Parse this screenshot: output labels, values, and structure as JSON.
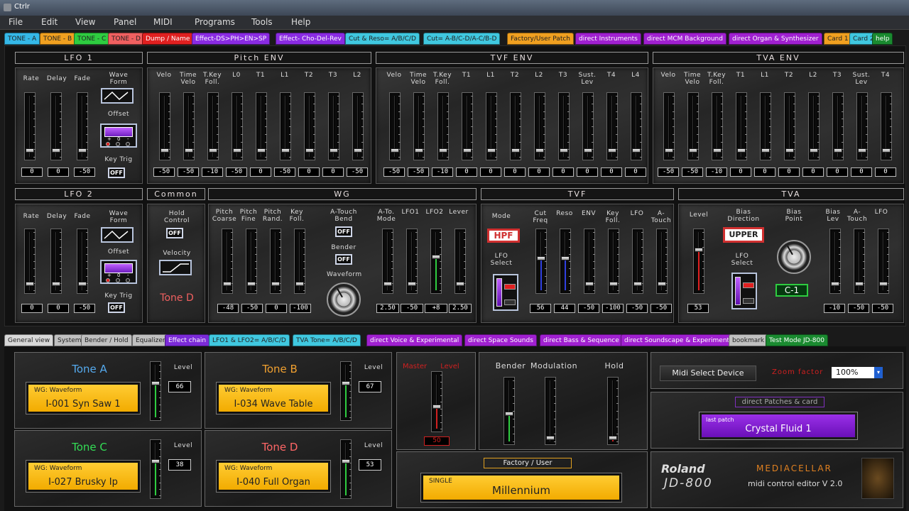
{
  "app": {
    "title": "Ctrlr"
  },
  "menu": [
    "File",
    "Edit",
    "View",
    "Panel",
    "MIDI",
    "Programs",
    "Tools",
    "Help"
  ],
  "tabs_top": [
    {
      "label": "TONE - A",
      "bg": "#35b8e8"
    },
    {
      "label": "TONE - B",
      "bg": "#f0a020"
    },
    {
      "label": "TONE - C",
      "bg": "#2ecc40"
    },
    {
      "label": "TONE - D",
      "bg": "#f06060"
    },
    {
      "label": "Dump / Name",
      "bg": "#e02020"
    },
    {
      "label": "Effect-DS>PH>EN>SP",
      "bg": "#8a2be2"
    },
    {
      "label": "Effect- Cho-Del-Rev",
      "bg": "#8a2be2"
    },
    {
      "label": "Cut & Reso= A/B/C/D",
      "bg": "#40c8e0"
    },
    {
      "label": "Cut= A-B/C-D/A-C/B-D",
      "bg": "#40c8e0"
    },
    {
      "label": "Factory/User Patch",
      "bg": "#f0a020"
    },
    {
      "label": "direct Instruments",
      "bg": "#a020d0"
    },
    {
      "label": "direct MCM Background",
      "bg": "#a020d0"
    },
    {
      "label": "direct Organ & Synthesizer",
      "bg": "#a020d0"
    },
    {
      "label": "Card 1",
      "bg": "#f0a020"
    },
    {
      "label": "Card 2",
      "bg": "#40c8e0"
    },
    {
      "label": "help",
      "bg": "#1a8a30"
    }
  ],
  "tabs_bottom": [
    {
      "label": "General view",
      "bg": "#d8d8d8"
    },
    {
      "label": "System",
      "bg": "#c0c0c0"
    },
    {
      "label": "Bender / Hold",
      "bg": "#c0c0c0"
    },
    {
      "label": "Equalizer",
      "bg": "#c0c0c0"
    },
    {
      "label": "Effect chain",
      "bg": "#7b2ad8"
    },
    {
      "label": "LFO1 & LFO2= A/B/C/D",
      "bg": "#40c8e0"
    },
    {
      "label": "TVA Tone= A/B/C/D",
      "bg": "#40c8e0"
    },
    {
      "label": "direct Voice & Experimental",
      "bg": "#a020d0"
    },
    {
      "label": "direct Space Sounds",
      "bg": "#a020d0"
    },
    {
      "label": "direct Bass & Sequence",
      "bg": "#a020d0"
    },
    {
      "label": "direct Soundscape & Experimental",
      "bg": "#a020d0"
    },
    {
      "label": "bookmark",
      "bg": "#c0c0c0"
    },
    {
      "label": "Test Mode JD-800",
      "bg": "#1a8a30"
    }
  ],
  "sections": {
    "lfo1": "LFO 1",
    "pitch_env": "Pitch ENV",
    "tvf_env": "TVF ENV",
    "tva_env": "TVA ENV",
    "lfo2": "LFO 2",
    "common": "Common",
    "wg": "WG",
    "tvf": "TVF",
    "tva": "TVA"
  },
  "lfo1": {
    "labels": [
      "Rate",
      "Delay",
      "Fade"
    ],
    "values": [
      "0",
      "0",
      "-50"
    ],
    "waveform": "Wave\nForm",
    "offset": "Offset",
    "keytrig": "Key Trig",
    "off": "OFF",
    "offset_marks": [
      "+",
      "0",
      "-"
    ]
  },
  "pitch_env": {
    "labels": [
      "Velo",
      "Time\nVelo",
      "T.Key\nFoll.",
      "L0",
      "T1",
      "L1",
      "T2",
      "T3",
      "L2"
    ],
    "values": [
      "-50",
      "-50",
      "-10",
      "-50",
      "0",
      "-50",
      "0",
      "0",
      "-50"
    ]
  },
  "tvf_env": {
    "labels": [
      "Velo",
      "Time\nVelo",
      "T.Key\nFoll.",
      "T1",
      "L1",
      "T2",
      "L2",
      "T3",
      "Sust.\nLev",
      "T4",
      "L4"
    ],
    "values": [
      "-50",
      "-50",
      "-10",
      "0",
      "0",
      "0",
      "0",
      "0",
      "0",
      "0",
      "0"
    ]
  },
  "tva_env": {
    "labels": [
      "Velo",
      "Time\nVelo",
      "T.Key\nFoll.",
      "T1",
      "L1",
      "T2",
      "L2",
      "T3",
      "Sust.\nLev",
      "T4"
    ],
    "values": [
      "-50",
      "-50",
      "-10",
      "0",
      "0",
      "0",
      "0",
      "0",
      "0",
      "0"
    ]
  },
  "lfo2": {
    "labels": [
      "Rate",
      "Delay",
      "Fade"
    ],
    "values": [
      "0",
      "0",
      "-50"
    ],
    "waveform": "Wave\nForm",
    "offset": "Offset",
    "keytrig": "Key Trig",
    "off": "OFF"
  },
  "common": {
    "hold": "Hold\nControl",
    "velocity": "Velocity",
    "off": "OFF",
    "tone": "Tone D"
  },
  "wg": {
    "labels": [
      "Pitch\nCoarse",
      "Pitch\nFine",
      "Pitch\nRand.",
      "Key\nFoll."
    ],
    "values": [
      "-48",
      "-50",
      "0",
      "-100"
    ],
    "atouch": "A-Touch\nBend",
    "bender": "Bender",
    "waveform": "Waveform",
    "off": "OFF",
    "labels2": [
      "A-To.\nMode",
      "LFO1",
      "LFO2",
      "Lever"
    ],
    "values2": [
      "2.50",
      "-50",
      "+8",
      "2.50"
    ]
  },
  "tvf": {
    "mode": "Mode",
    "hpf": "HPF",
    "lfo_select": "LFO\nSelect",
    "labels": [
      "Cut\nFreq",
      "Reso",
      "ENV",
      "Key\nFoll.",
      "LFO",
      "A-\nTouch"
    ],
    "values": [
      "56",
      "44",
      "-50",
      "-100",
      "-50",
      "-50"
    ]
  },
  "tva": {
    "level": "Level",
    "level_value": "53",
    "bias_dir": "Bias\nDirection",
    "upper": "UPPER",
    "bias_point": "Bias\nPoint",
    "bias_point_value": "C-1",
    "lfo_select": "LFO\nSelect",
    "labels": [
      "Bias\nLev",
      "A-\nTouch",
      "LFO"
    ],
    "values": [
      "-10",
      "-50",
      "-50"
    ]
  },
  "general": {
    "tones": [
      {
        "name": "Tone A",
        "color": "#55aaee",
        "wg": "WG: Waveform",
        "wave": "I-001 Syn Saw 1",
        "level_label": "Level",
        "level": "66"
      },
      {
        "name": "Tone B",
        "color": "#f0a030",
        "wg": "WG: Waveform",
        "wave": "I-034 Wave Table",
        "level_label": "Level",
        "level": "67"
      },
      {
        "name": "Tone C",
        "color": "#33dd55",
        "wg": "WG: Waveform",
        "wave": "I-027 Brusky Ip",
        "level_label": "Level",
        "level": "38"
      },
      {
        "name": "Tone D",
        "color": "#ff6666",
        "wg": "WG: Waveform",
        "wave": "I-040 Full Organ",
        "level_label": "Level",
        "level": "53"
      }
    ],
    "master_label": "Master      Level",
    "master_value": "50",
    "bender": "Bender",
    "modulation": "Modulation",
    "hold": "Hold",
    "midi_button": "Midi Select Device",
    "zoom_label": "Zoom factor",
    "zoom_value": "100%",
    "direct_patches": "direct Patches & card",
    "last_patch": "last patch",
    "patch_name": "Crystal Fluid 1",
    "factory_user": "Factory / User",
    "single": "SINGLE",
    "patch": "Millennium",
    "roland": "Roland",
    "model": "JD-800",
    "mediacellar": "MEDIACELLAR",
    "editor": "midi control editor V 2.0"
  }
}
